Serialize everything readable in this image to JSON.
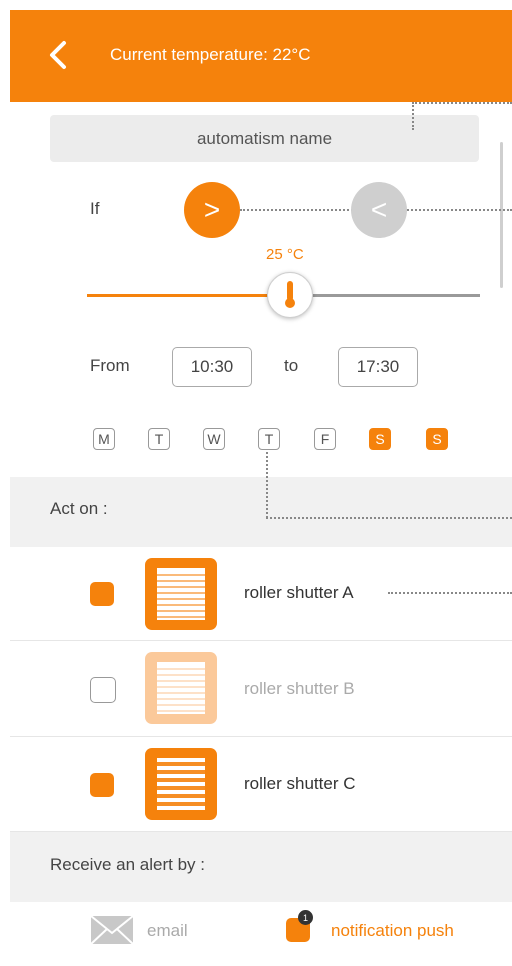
{
  "header": {
    "title": "Current temperature: 22°C"
  },
  "automation": {
    "name": "automatism name"
  },
  "condition": {
    "if_label": "If",
    "greater_symbol": ">",
    "less_symbol": "<",
    "selected": "greater"
  },
  "temperature": {
    "label": "25 °C",
    "value": 25,
    "level": 0.51
  },
  "time": {
    "from_label": "From",
    "from_value": "10:30",
    "to_label": "to",
    "to_value": "17:30"
  },
  "days": [
    {
      "label": "M",
      "active": false
    },
    {
      "label": "T",
      "active": false
    },
    {
      "label": "W",
      "active": false
    },
    {
      "label": "T",
      "active": false
    },
    {
      "label": "F",
      "active": false
    },
    {
      "label": "S",
      "active": true
    },
    {
      "label": "S",
      "active": true
    }
  ],
  "act_on": {
    "title": "Act on :",
    "items": [
      {
        "label": "roller shutter A",
        "checked": true
      },
      {
        "label": "roller shutter B",
        "checked": false
      },
      {
        "label": "roller shutter C",
        "checked": true
      }
    ]
  },
  "alert": {
    "title": "Receive an alert by :",
    "email_label": "email",
    "push_label": "notification push",
    "push_badge": "1"
  },
  "colors": {
    "accent": "#f5820c",
    "disabled": "#cfcfcf"
  },
  "icons": {
    "back": "chevron-left-icon",
    "thermometer": "thermometer-icon",
    "shutter": "roller-shutter-icon",
    "email": "envelope-icon",
    "push": "notification-icon"
  }
}
